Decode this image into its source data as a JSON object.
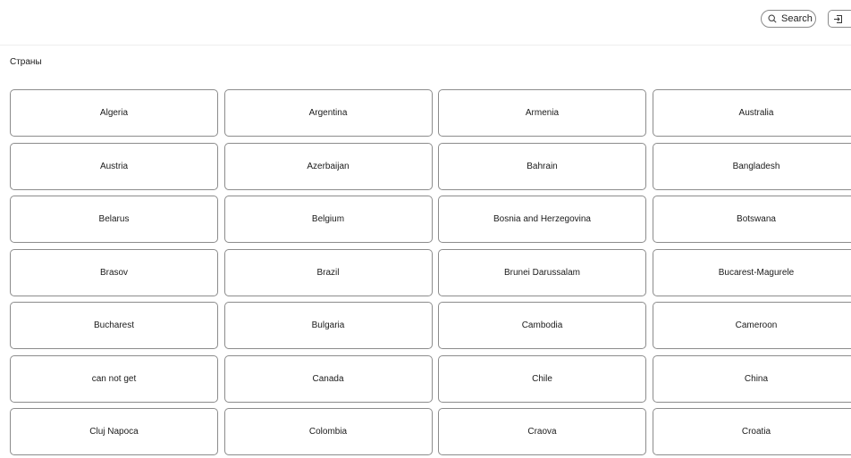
{
  "header": {
    "search_label": "Search",
    "search_icon": "search-icon",
    "login_icon": "sign-in-icon"
  },
  "section": {
    "title": "Страны"
  },
  "countries": [
    "Algeria",
    "Argentina",
    "Armenia",
    "Australia",
    "Austria",
    "Azerbaijan",
    "Bahrain",
    "Bangladesh",
    "Belarus",
    "Belgium",
    "Bosnia and Herzegovina",
    "Botswana",
    "Brasov",
    "Brazil",
    "Brunei Darussalam",
    "Bucarest-Magurele",
    "Bucharest",
    "Bulgaria",
    "Cambodia",
    "Cameroon",
    "can not get",
    "Canada",
    "Chile",
    "China",
    "Cluj Napoca",
    "Colombia",
    "Craova",
    "Croatia"
  ]
}
